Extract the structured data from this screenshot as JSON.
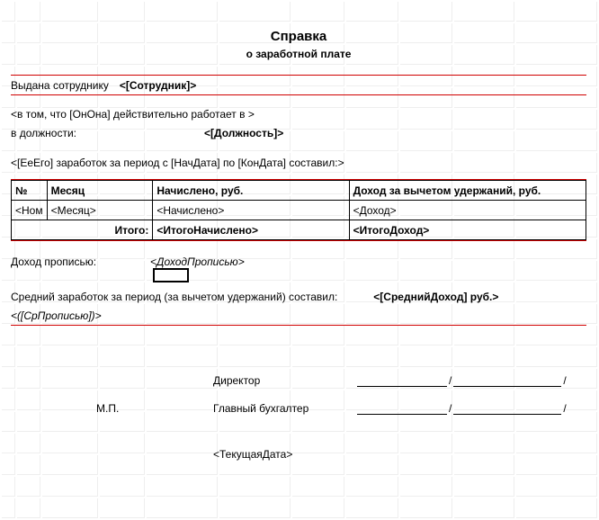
{
  "header": {
    "title": "Справка",
    "subtitle": "о заработной плате"
  },
  "issued": {
    "label": "Выдана сотруднику",
    "value": "<[Сотрудник]>"
  },
  "works_in": {
    "line1_prefix": "<в том, что [ОнОна] действительно работает в >",
    "line2_label": "в должности:",
    "line2_value": "<[Должность]>"
  },
  "period_line": "<[ЕеЕго] заработок за период с [НачДата] по  [КонДата] составил:>",
  "table": {
    "headers": [
      "№",
      "Месяц",
      "Начислено, руб.",
      "Доход за вычетом удержаний, руб."
    ],
    "row": [
      "<Ном",
      "<Месяц>",
      "<Начислено>",
      "<Доход>"
    ],
    "totals_label": "Итого:",
    "totals": [
      "<ИтогоНачислено>",
      "<ИтогоДоход>"
    ]
  },
  "income_words": {
    "label": "Доход прописью:",
    "value": "<ДоходПрописью>"
  },
  "average": {
    "label": "Средний заработок за период (за вычетом удержаний) составил:",
    "value": "<[СреднийДоход] руб.>",
    "words": "<([СрПрописью])>"
  },
  "director_label": "Директор",
  "chief_acc_label": "Главный бухгалтер",
  "mp_label": "М.П.",
  "date": "<ТекущаяДата>",
  "slash": "/"
}
